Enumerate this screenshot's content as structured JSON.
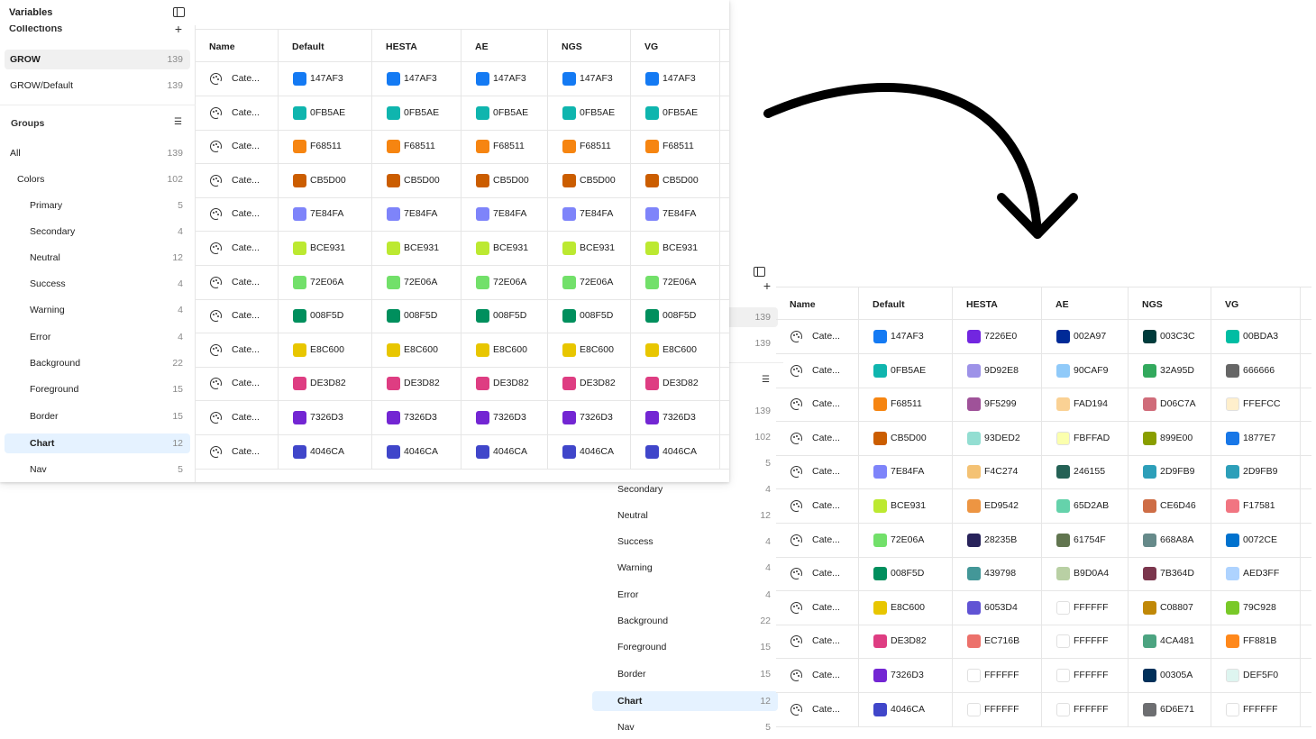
{
  "front": {
    "sidebar": {
      "title": "Variables",
      "collections_label": "Collections",
      "collections": [
        {
          "label": "GROW",
          "count": "139"
        },
        {
          "label": "GROW/Default",
          "count": "139"
        }
      ],
      "groups_label": "Groups",
      "groups": [
        {
          "label": "All",
          "count": "139"
        },
        {
          "label": "Colors",
          "count": "102"
        },
        {
          "label": "Primary",
          "count": "5"
        },
        {
          "label": "Secondary",
          "count": "4"
        },
        {
          "label": "Neutral",
          "count": "12"
        },
        {
          "label": "Success",
          "count": "4"
        },
        {
          "label": "Warning",
          "count": "4"
        },
        {
          "label": "Error",
          "count": "4"
        },
        {
          "label": "Background",
          "count": "22"
        },
        {
          "label": "Foreground",
          "count": "15"
        },
        {
          "label": "Border",
          "count": "15"
        },
        {
          "label": "Chart",
          "count": "12"
        },
        {
          "label": "Nav",
          "count": "5"
        }
      ]
    },
    "table": {
      "headers": [
        "Name",
        "Default",
        "HESTA",
        "AE",
        "NGS",
        "VG"
      ],
      "rows": [
        {
          "name": "Cate...",
          "values": [
            "147AF3",
            "147AF3",
            "147AF3",
            "147AF3",
            "147AF3"
          ]
        },
        {
          "name": "Cate...",
          "values": [
            "0FB5AE",
            "0FB5AE",
            "0FB5AE",
            "0FB5AE",
            "0FB5AE"
          ]
        },
        {
          "name": "Cate...",
          "values": [
            "F68511",
            "F68511",
            "F68511",
            "F68511",
            "F68511"
          ]
        },
        {
          "name": "Cate...",
          "values": [
            "CB5D00",
            "CB5D00",
            "CB5D00",
            "CB5D00",
            "CB5D00"
          ]
        },
        {
          "name": "Cate...",
          "values": [
            "7E84FA",
            "7E84FA",
            "7E84FA",
            "7E84FA",
            "7E84FA"
          ]
        },
        {
          "name": "Cate...",
          "values": [
            "BCE931",
            "BCE931",
            "BCE931",
            "BCE931",
            "BCE931"
          ]
        },
        {
          "name": "Cate...",
          "values": [
            "72E06A",
            "72E06A",
            "72E06A",
            "72E06A",
            "72E06A"
          ]
        },
        {
          "name": "Cate...",
          "values": [
            "008F5D",
            "008F5D",
            "008F5D",
            "008F5D",
            "008F5D"
          ]
        },
        {
          "name": "Cate...",
          "values": [
            "E8C600",
            "E8C600",
            "E8C600",
            "E8C600",
            "E8C600"
          ]
        },
        {
          "name": "Cate...",
          "values": [
            "DE3D82",
            "DE3D82",
            "DE3D82",
            "DE3D82",
            "DE3D82"
          ]
        },
        {
          "name": "Cate...",
          "values": [
            "7326D3",
            "7326D3",
            "7326D3",
            "7326D3",
            "7326D3"
          ]
        },
        {
          "name": "Cate...",
          "values": [
            "4046CA",
            "4046CA",
            "4046CA",
            "4046CA",
            "4046CA"
          ]
        }
      ]
    }
  },
  "back": {
    "sidebar": {
      "collections": [
        {
          "label": "",
          "count": "139"
        },
        {
          "label": "",
          "count": "139"
        }
      ],
      "groups": [
        {
          "label": "",
          "count": "139"
        },
        {
          "label": "",
          "count": "102"
        },
        {
          "label": "",
          "count": "5"
        },
        {
          "label": "Secondary",
          "count": "4"
        },
        {
          "label": "Neutral",
          "count": "12"
        },
        {
          "label": "Success",
          "count": "4"
        },
        {
          "label": "Warning",
          "count": "4"
        },
        {
          "label": "Error",
          "count": "4"
        },
        {
          "label": "Background",
          "count": "22"
        },
        {
          "label": "Foreground",
          "count": "15"
        },
        {
          "label": "Border",
          "count": "15"
        },
        {
          "label": "Chart",
          "count": "12"
        },
        {
          "label": "Nav",
          "count": "5"
        }
      ]
    },
    "table": {
      "headers": [
        "Name",
        "Default",
        "HESTA",
        "AE",
        "NGS",
        "VG"
      ],
      "rows": [
        {
          "name": "Cate...",
          "values": [
            "147AF3",
            "7226E0",
            "002A97",
            "003C3C",
            "00BDA3"
          ]
        },
        {
          "name": "Cate...",
          "values": [
            "0FB5AE",
            "9D92E8",
            "90CAF9",
            "32A95D",
            "666666"
          ]
        },
        {
          "name": "Cate...",
          "values": [
            "F68511",
            "9F5299",
            "FAD194",
            "D06C7A",
            "FFEFCC"
          ]
        },
        {
          "name": "Cate...",
          "values": [
            "CB5D00",
            "93DED2",
            "FBFFAD",
            "899E00",
            "1877E7"
          ]
        },
        {
          "name": "Cate...",
          "values": [
            "7E84FA",
            "F4C274",
            "246155",
            "2D9FB9",
            "2D9FB9"
          ]
        },
        {
          "name": "Cate...",
          "values": [
            "BCE931",
            "ED9542",
            "65D2AB",
            "CE6D46",
            "F17581"
          ]
        },
        {
          "name": "Cate...",
          "values": [
            "72E06A",
            "28235B",
            "61754F",
            "668A8A",
            "0072CE"
          ]
        },
        {
          "name": "Cate...",
          "values": [
            "008F5D",
            "439798",
            "B9D0A4",
            "7B364D",
            "AED3FF"
          ]
        },
        {
          "name": "Cate...",
          "values": [
            "E8C600",
            "6053D4",
            "FFFFFF",
            "C08807",
            "79C928"
          ]
        },
        {
          "name": "Cate...",
          "values": [
            "DE3D82",
            "EC716B",
            "FFFFFF",
            "4CA481",
            "FF881B"
          ]
        },
        {
          "name": "Cate...",
          "values": [
            "7326D3",
            "FFFFFF",
            "FFFFFF",
            "00305A",
            "DEF5F0"
          ]
        },
        {
          "name": "Cate...",
          "values": [
            "4046CA",
            "FFFFFF",
            "FFFFFF",
            "6D6E71",
            "FFFFFF"
          ]
        }
      ]
    }
  },
  "icons": {
    "sidebar_toggle": "sidebar-toggle-icon",
    "add": "plus-icon",
    "groups_filter": "filter-list-icon",
    "row_type": "palette-icon",
    "arrow": "curved-arrow-icon"
  }
}
